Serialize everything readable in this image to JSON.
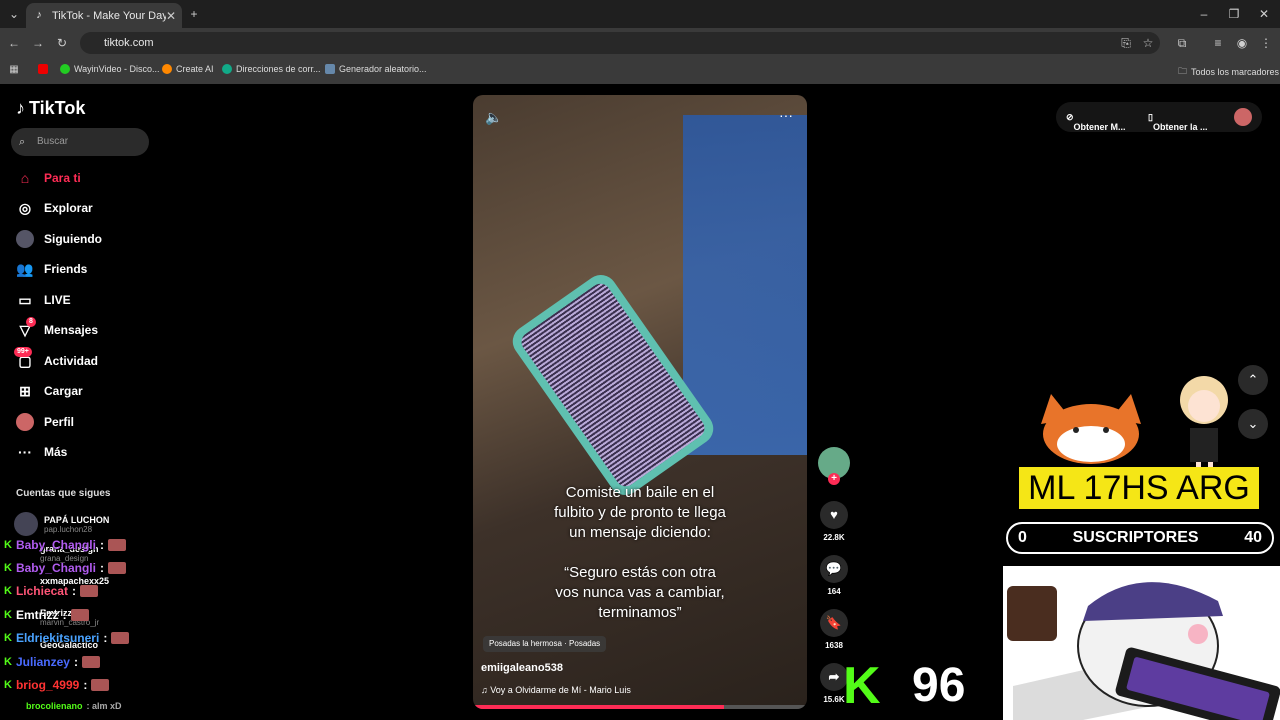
{
  "browser": {
    "tab_title": "TikTok - Make Your Day",
    "url": "tiktok.com",
    "bookmarks": [
      "WayinVideo - Disco...",
      "Create AI",
      "Direcciones de corr...",
      "Generador aleatorio..."
    ],
    "all_bookmarks": "Todos los marcadores"
  },
  "sidebar": {
    "logo": "TikTok",
    "search_placeholder": "Buscar",
    "nav": [
      {
        "label": "Para ti",
        "icon": "home-icon"
      },
      {
        "label": "Explorar",
        "icon": "compass-icon"
      },
      {
        "label": "Siguiendo",
        "icon": "following-avatar-icon"
      },
      {
        "label": "Friends",
        "icon": "friends-icon"
      },
      {
        "label": "LIVE",
        "icon": "live-icon"
      },
      {
        "label": "Mensajes",
        "icon": "messages-icon",
        "badge": "8"
      },
      {
        "label": "Actividad",
        "icon": "activity-icon",
        "badge": "99+"
      },
      {
        "label": "Cargar",
        "icon": "upload-icon"
      },
      {
        "label": "Perfil",
        "icon": "profile-icon"
      },
      {
        "label": "Más",
        "icon": "more-icon"
      }
    ],
    "following_header": "Cuentas que sigues",
    "accounts": [
      {
        "name": "PAPÁ LUCHON",
        "handle": "pap.luchon28"
      },
      {
        "name": "grana_design",
        "handle": "grana_design"
      },
      {
        "name": "xxmapachexx25",
        "handle": ""
      },
      {
        "name": "Emtrizz",
        "handle": "marvin_castro_jr"
      },
      {
        "name": "GeoGalactico",
        "handle": ""
      }
    ]
  },
  "chat": [
    {
      "user": "Baby_Changli",
      "color": "#b15cf0",
      "msg": ":"
    },
    {
      "user": "Baby_Changli",
      "color": "#b15cf0",
      "msg": ":"
    },
    {
      "user": "Lichiecat",
      "color": "#ff5577",
      "msg": ":"
    },
    {
      "user": "Emtrizz",
      "color": "#ffffff",
      "msg": ":"
    },
    {
      "user": "Eldriekitsuneri",
      "color": "#4aa3ff",
      "msg": ":"
    },
    {
      "user": "Julianzey",
      "color": "#4a6bff",
      "msg": ":"
    },
    {
      "user": "briog_4999",
      "color": "#ff3333",
      "msg": ":"
    },
    {
      "user": "brocolienano",
      "color": "#53fc18",
      "msg": ": alm xD"
    }
  ],
  "video": {
    "caption": "Comiste un baile en el\nfulbito y de pronto te llega\nun mensaje diciendo:\n\n“Seguro estás con otra\nvos nunca vas a cambiar,\nterminamos”",
    "tag": "Posadas la hermosa · Posadas",
    "username": "emiigaleano538",
    "music": "Voy a Olvidarme de Mí - Mario Luis",
    "likes": "22.8K",
    "comments": "164",
    "saves": "1638",
    "shares": "15.6K",
    "progress": 0.75
  },
  "topright": {
    "btn1": "Obtener M...",
    "btn2": "Obtener la ..."
  },
  "overlay": {
    "banner": "ML 17HS ARG",
    "subs_left": "0",
    "subs_label": "SUSCRIPTORES",
    "subs_right": "40",
    "k_logo": "K",
    "k_count": "96"
  }
}
